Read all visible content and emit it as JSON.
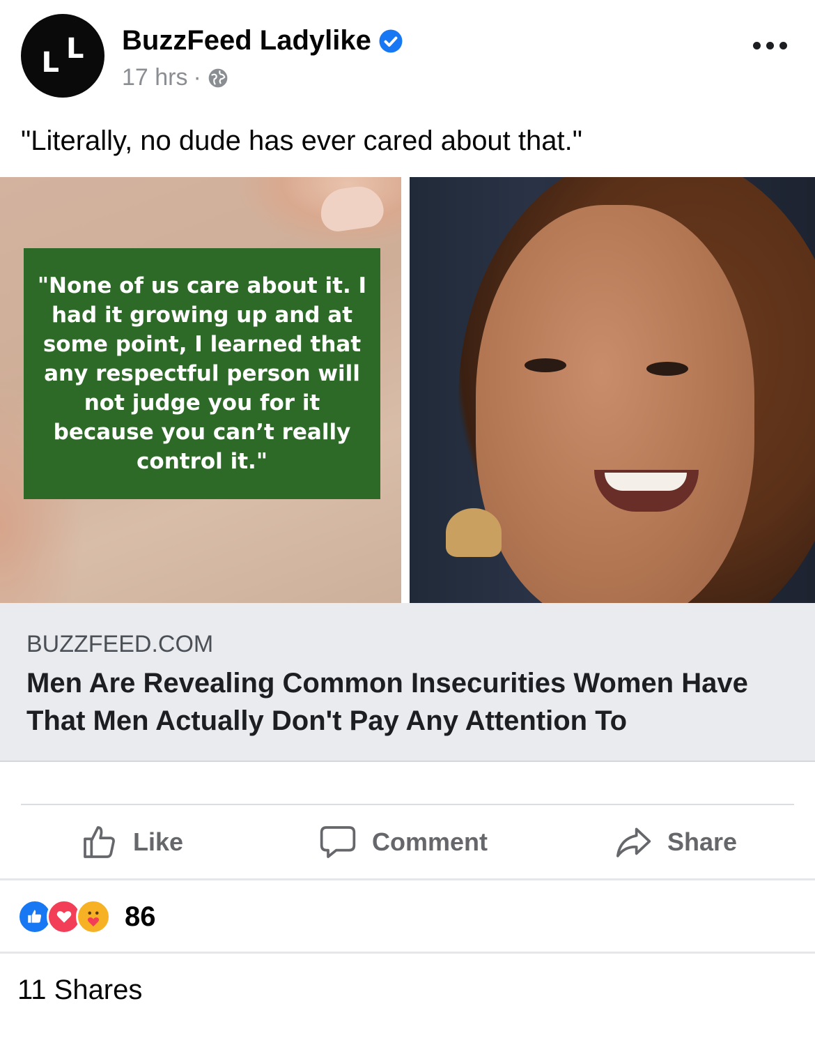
{
  "post": {
    "page_name": "BuzzFeed Ladylike",
    "avatar_text": [
      "L",
      "L"
    ],
    "time": "17 hrs",
    "meta_separator": "·",
    "audience_icon": "globe-icon",
    "verified_icon": "verified-badge-icon",
    "more_icon": "more-options-icon",
    "caption": "\"Literally, no dude has ever cared about that.\""
  },
  "image": {
    "quote": "\"None of us care about it. I had it growing up and at some point, I learned that any respectful person will not judge you for it because you can’t really control it.\"",
    "quote_bg": "#2d6a27"
  },
  "link": {
    "domain": "BUZZFEED.COM",
    "title": "Men Are Revealing Common Insecurities Women Have That Men Actually Don't Pay Any Attention To"
  },
  "actions": {
    "like": "Like",
    "comment": "Comment",
    "share": "Share"
  },
  "stats": {
    "reaction_count": "86",
    "reaction_icons": [
      "like-reaction-icon",
      "love-reaction-icon",
      "care-reaction-icon"
    ],
    "shares": "11 Shares"
  },
  "colors": {
    "accent": "#1877f2",
    "secondary_text": "#65676b",
    "link_box_bg": "#e9ebee"
  }
}
